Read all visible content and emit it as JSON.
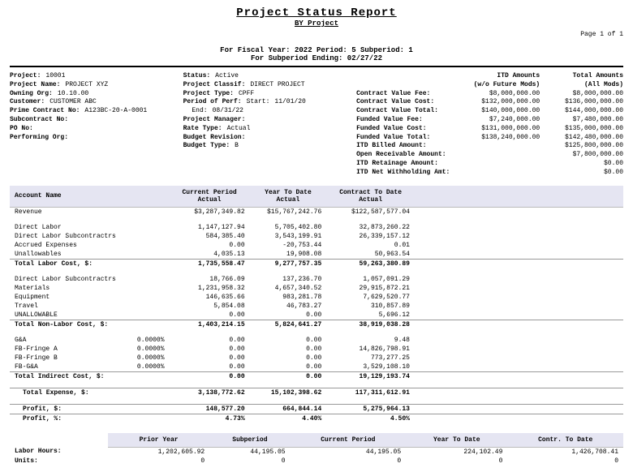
{
  "report": {
    "title": "Project Status Report",
    "subtitle": "BY Project",
    "page": "Page 1 of 1",
    "fiscal_line1": "For Fiscal Year: 2022 Period: 5 Subperiod: 1",
    "fiscal_line2": "For Subperiod Ending: 02/27/22"
  },
  "project_info": {
    "labels": {
      "project": "Project:",
      "project_name": "Project Name:",
      "owning_org": "Owning Org:",
      "customer": "Customer:",
      "prime_contract_no": "Prime Contract No:",
      "subcontract_no": "Subcontract No:",
      "po_no": "PO No:",
      "performing_org": "Performing Org:"
    },
    "values": {
      "project": "10001",
      "project_name": "PROJECT XYZ",
      "owning_org": "10.10.00",
      "customer": "CUSTOMER ABC",
      "prime_contract_no": "A123BC-20-A-0001",
      "subcontract_no": "",
      "po_no": "",
      "performing_org": ""
    }
  },
  "status_info": {
    "labels": {
      "status": "Status:",
      "project_classif": "Project Classif:",
      "project_type": "Project Type:",
      "period_of_perf": "Period of Perf:",
      "pop_start": "Start:",
      "pop_end": "End:",
      "project_manager": "Project Manager:",
      "rate_type": "Rate Type:",
      "budget_revision": "Budget Revision:",
      "budget_type": "Budget Type:"
    },
    "values": {
      "status": "Active",
      "project_classif": "DIRECT PROJECT",
      "project_type": "CPFF",
      "pop_start": "11/01/20",
      "pop_end": "08/31/22",
      "project_manager": "",
      "rate_type": "Actual",
      "budget_revision": "",
      "budget_type": "B"
    }
  },
  "amounts": {
    "head1": "ITD Amounts",
    "head1_sub": "(w/o Future Mods)",
    "head2": "Total Amounts",
    "head2_sub": "(All Mods)",
    "rows": [
      {
        "label": "Contract Value Fee:",
        "c1": "$8,000,000.00",
        "c2": "$8,000,000.00"
      },
      {
        "label": "Contract Value Cost:",
        "c1": "$132,000,000.00",
        "c2": "$136,000,000.00"
      },
      {
        "label": "Contract Value Total:",
        "c1": "$140,000,000.00",
        "c2": "$144,000,000.00"
      },
      {
        "label": "Funded Value Fee:",
        "c1": "$7,240,000.00",
        "c2": "$7,480,000.00"
      },
      {
        "label": "Funded Value Cost:",
        "c1": "$131,000,000.00",
        "c2": "$135,000,000.00"
      },
      {
        "label": "Funded Value Total:",
        "c1": "$138,240,000.00",
        "c2": "$142,480,000.00"
      },
      {
        "label": "ITD Billed Amount:",
        "c1": "",
        "c2": "$125,800,000.00"
      },
      {
        "label": "Open Receivable Amount:",
        "c1": "",
        "c2": "$7,800,000.00"
      },
      {
        "label": "ITD Retainage Amount:",
        "c1": "",
        "c2": "$0.00"
      },
      {
        "label": "ITD Net Withholding Amt:",
        "c1": "",
        "c2": "$0.00"
      }
    ]
  },
  "table_head": {
    "account_name": "Account Name",
    "cur": "Current\nPeriod\nActual",
    "ytd": "Year\nTo Date\nActual",
    "ctd": "Contract\nTo Date\nActual"
  },
  "rows": {
    "revenue": {
      "label": "Revenue",
      "pct": "",
      "cur": "$3,287,349.82",
      "ytd": "$15,767,242.76",
      "ctd": "$122,587,577.04"
    },
    "direct_labor": {
      "label": "Direct Labor",
      "pct": "",
      "cur": "1,147,127.94",
      "ytd": "5,705,402.80",
      "ctd": "32,873,260.22"
    },
    "dl_subs": {
      "label": "Direct Labor Subcontractrs",
      "pct": "",
      "cur": "584,385.40",
      "ytd": "3,543,199.91",
      "ctd": "26,339,157.12"
    },
    "accrued": {
      "label": "Accrued Expenses",
      "pct": "",
      "cur": "0.00",
      "ytd": "-20,753.44",
      "ctd": "0.01"
    },
    "unallowables": {
      "label": "Unallowables",
      "pct": "",
      "cur": "4,035.13",
      "ytd": "19,908.08",
      "ctd": "50,963.54"
    },
    "tl_total": {
      "label": "Total Labor Cost, $:",
      "pct": "",
      "cur": "1,735,558.47",
      "ytd": "9,277,757.35",
      "ctd": "59,263,380.89"
    },
    "nl_subs": {
      "label": "Direct Labor Subcontractrs",
      "pct": "",
      "cur": "18,766.09",
      "ytd": "137,236.70",
      "ctd": "1,057,091.29"
    },
    "materials": {
      "label": "Materials",
      "pct": "",
      "cur": "1,231,958.32",
      "ytd": "4,657,340.52",
      "ctd": "29,915,872.21"
    },
    "equipment": {
      "label": "Equipment",
      "pct": "",
      "cur": "146,635.66",
      "ytd": "983,281.78",
      "ctd": "7,629,520.77"
    },
    "travel": {
      "label": "Travel",
      "pct": "",
      "cur": "5,854.08",
      "ytd": "46,783.27",
      "ctd": "310,857.89"
    },
    "unallowable2": {
      "label": "UNALLOWABLE",
      "pct": "",
      "cur": "0.00",
      "ytd": "0.00",
      "ctd": "5,696.12"
    },
    "tnl_total": {
      "label": "Total Non-Labor Cost, $:",
      "pct": "",
      "cur": "1,403,214.15",
      "ytd": "5,824,641.27",
      "ctd": "38,919,038.28"
    },
    "ga": {
      "label": "G&A",
      "pct": "0.0000%",
      "cur": "0.00",
      "ytd": "0.00",
      "ctd": "9.48"
    },
    "fringe_a": {
      "label": "FB-Fringe A",
      "pct": "0.0000%",
      "cur": "0.00",
      "ytd": "0.00",
      "ctd": "14,826,798.91"
    },
    "fringe_b": {
      "label": "FB-Fringe B",
      "pct": "0.0000%",
      "cur": "0.00",
      "ytd": "0.00",
      "ctd": "773,277.25"
    },
    "fb_ga": {
      "label": "FB-G&A",
      "pct": "0.0000%",
      "cur": "0.00",
      "ytd": "0.00",
      "ctd": "3,529,108.10"
    },
    "indirect_total": {
      "label": "Total Indirect Cost, $:",
      "pct": "",
      "cur": "0.00",
      "ytd": "0.00",
      "ctd": "19,129,193.74"
    },
    "total_expense": {
      "label": "Total Expense, $:",
      "pct": "",
      "cur": "3,138,772.62",
      "ytd": "15,102,398.62",
      "ctd": "117,311,612.91"
    },
    "profit_dollar": {
      "label": "Profit, $:",
      "pct": "",
      "cur": "148,577.20",
      "ytd": "664,844.14",
      "ctd": "5,275,964.13"
    },
    "profit_pct": {
      "label": "Profit, %:",
      "pct": "",
      "cur": "4.73%",
      "ytd": "4.40%",
      "ctd": "4.50%"
    }
  },
  "summary_head": {
    "blank": "",
    "prior": "Prior Year",
    "sub": "Subperiod",
    "cur": "Current Period",
    "ytd": "Year To Date",
    "ctd": "Contr. To Date"
  },
  "summary": {
    "labor_hours": {
      "label": "Labor Hours:",
      "prior": "1,202,605.92",
      "sub": "44,195.05",
      "cur": "44,195.05",
      "ytd": "224,102.49",
      "ctd": "1,426,708.41"
    },
    "units": {
      "label": "Units:",
      "prior": "0",
      "sub": "0",
      "cur": "0",
      "ytd": "0",
      "ctd": "0"
    }
  }
}
